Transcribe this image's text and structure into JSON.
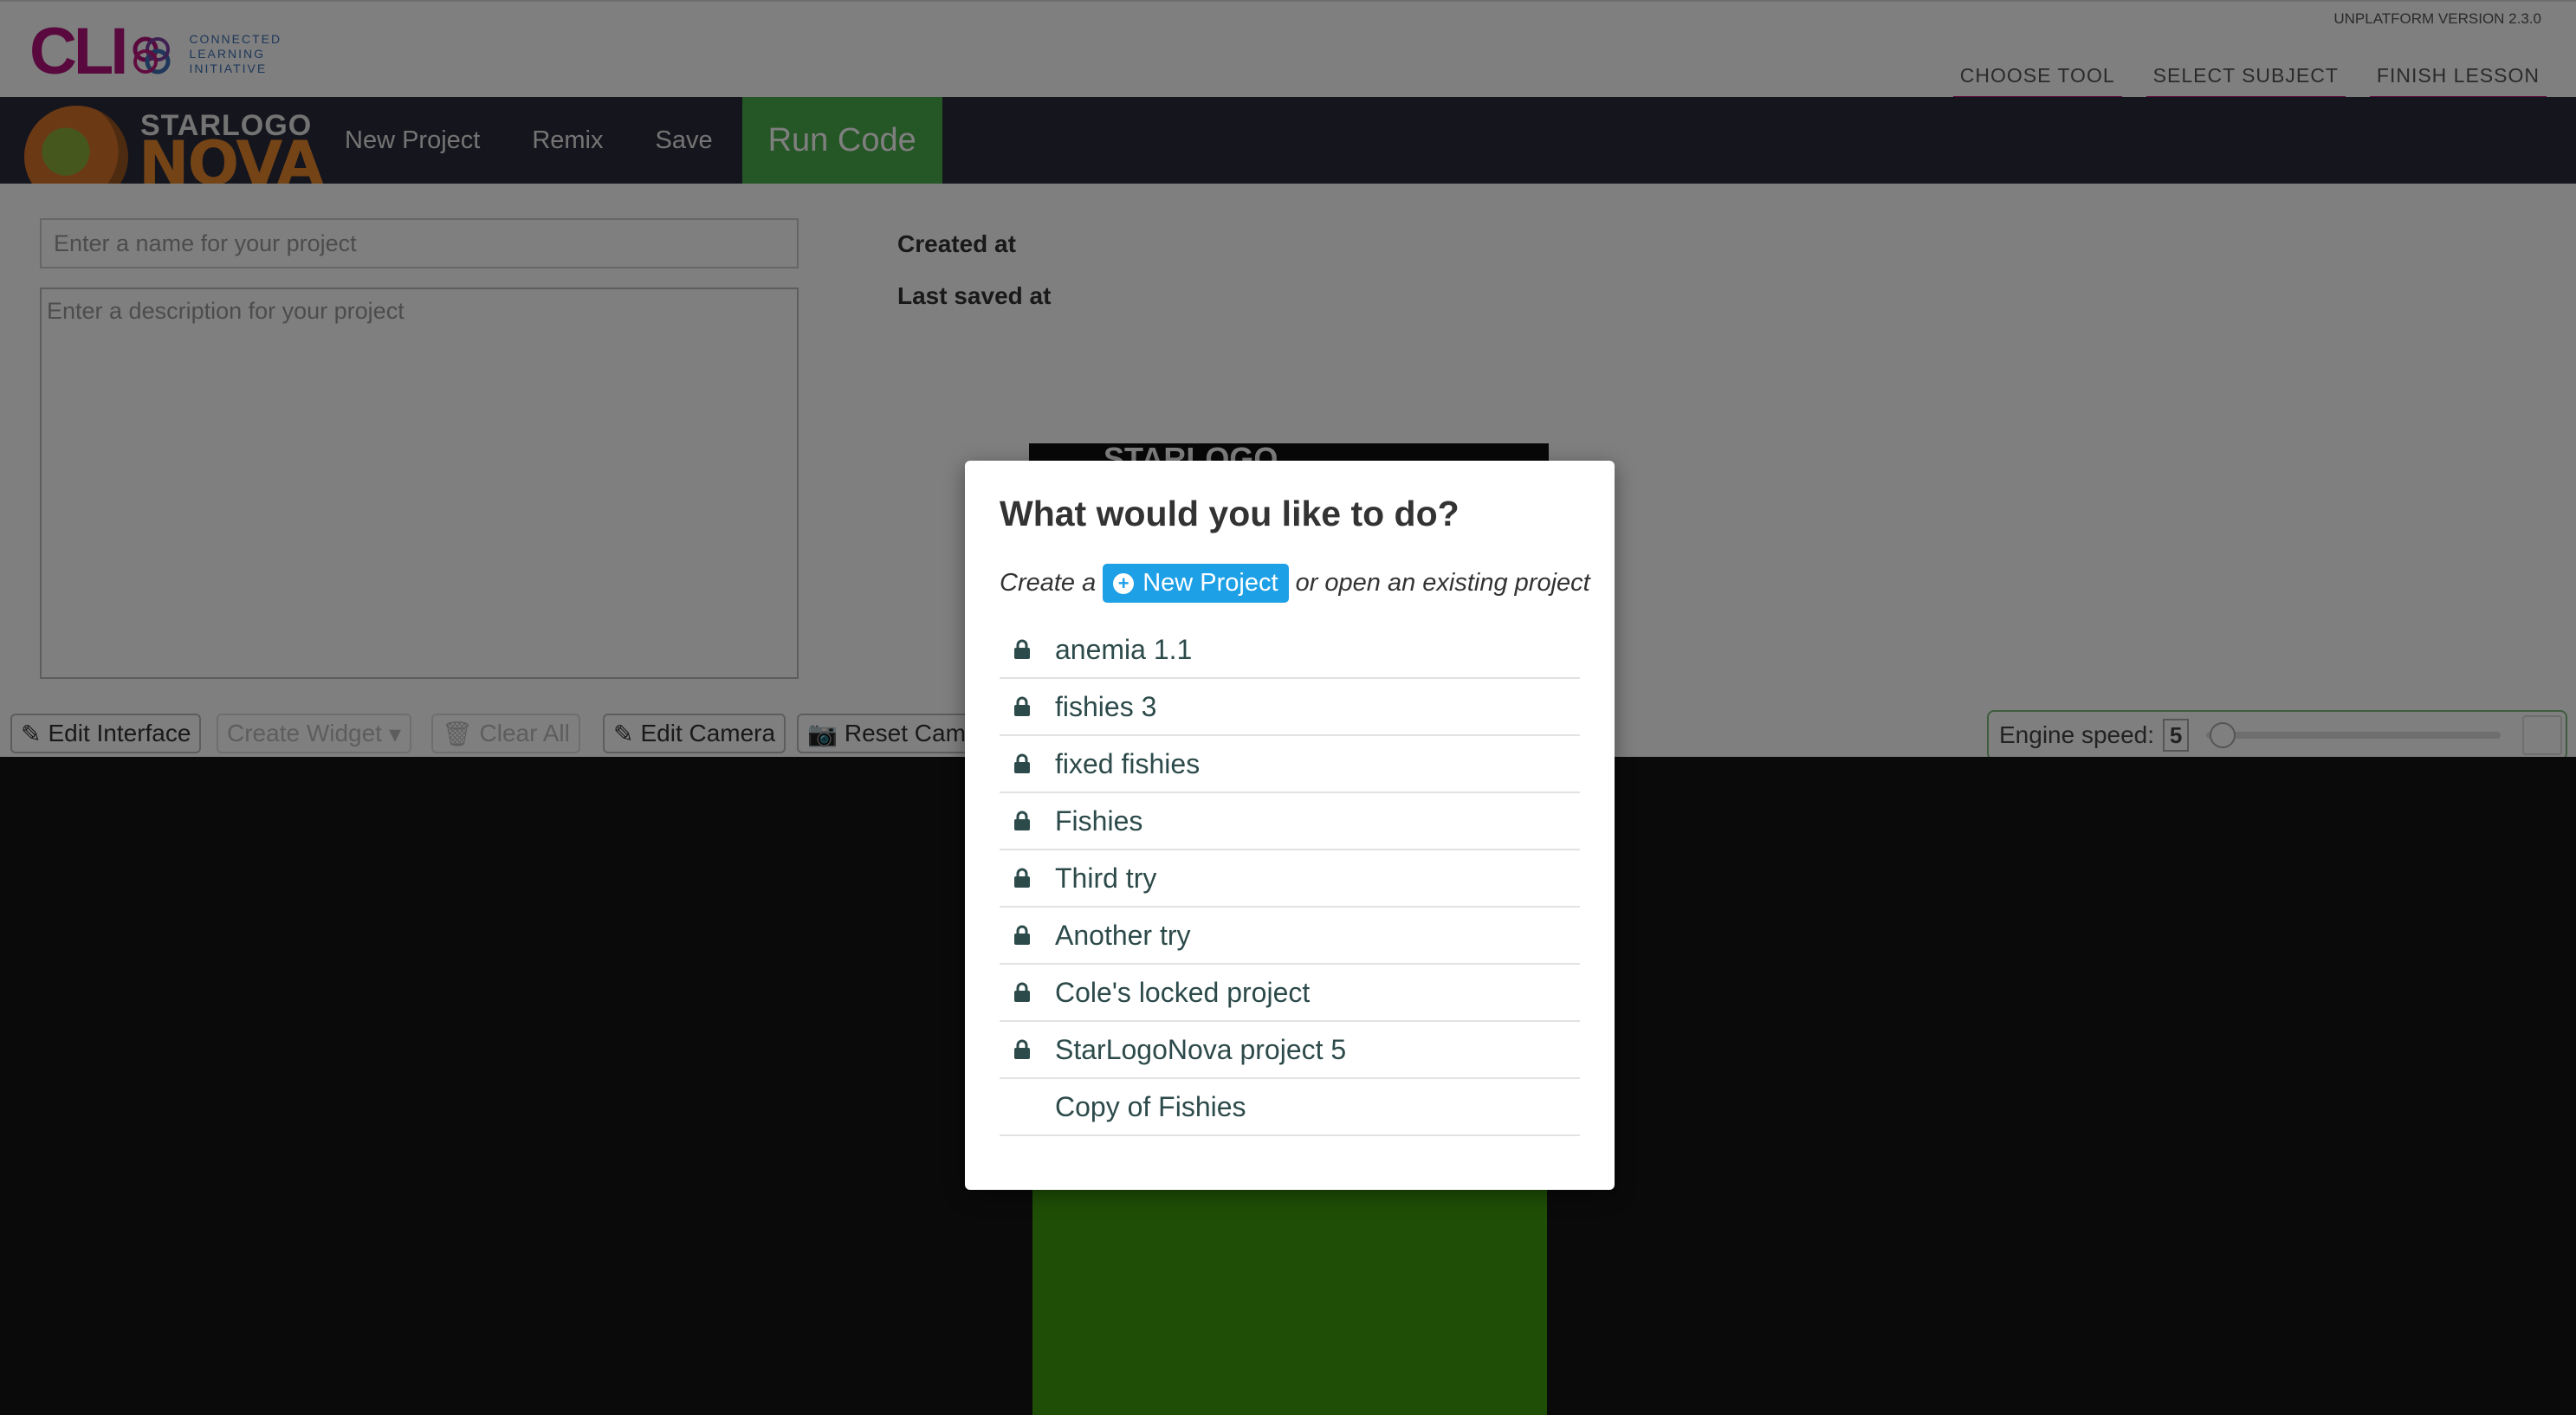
{
  "cli": {
    "logo_text": "CLI",
    "subtitle": [
      "CONNECTED",
      "LEARNING",
      "INITIATIVE"
    ],
    "version": "UNPLATFORM VERSION 2.3.0",
    "nav": [
      "CHOOSE TOOL",
      "SELECT SUBJECT",
      "FINISH LESSON"
    ],
    "brand_color": "#b3127a"
  },
  "app": {
    "logo_top": "STARLOGO",
    "logo_bottom": "NOVA",
    "menu": [
      "New Project",
      "Remix",
      "Save"
    ],
    "run_label": "Run Code",
    "run_color": "#4bad4b"
  },
  "project": {
    "name_placeholder": "Enter a name for your project",
    "desc_placeholder": "Enter a description for your project",
    "created_label": "Created at",
    "saved_label": "Last saved at",
    "preview_text": "STARLOGO"
  },
  "toolbar": {
    "edit_interface": "Edit Interface",
    "create_widget": "Create Widget",
    "clear_all": "Clear All",
    "edit_camera": "Edit Camera",
    "reset_camera": "Reset Camera",
    "engine_label": "Engine speed:",
    "engine_value": "5"
  },
  "modal": {
    "title": "What would you like to do?",
    "intro_before": "Create a",
    "new_project_label": "New Project",
    "intro_after": "or open an existing project",
    "projects": [
      {
        "name": "anemia 1.1",
        "locked": true
      },
      {
        "name": "fishies 3",
        "locked": true
      },
      {
        "name": "fixed fishies",
        "locked": true
      },
      {
        "name": "Fishies",
        "locked": true
      },
      {
        "name": "Third try",
        "locked": true
      },
      {
        "name": "Another try",
        "locked": true
      },
      {
        "name": "Cole's locked project",
        "locked": true
      },
      {
        "name": "StarLogoNova project 5",
        "locked": true
      },
      {
        "name": "Copy of Fishies",
        "locked": false
      }
    ]
  }
}
